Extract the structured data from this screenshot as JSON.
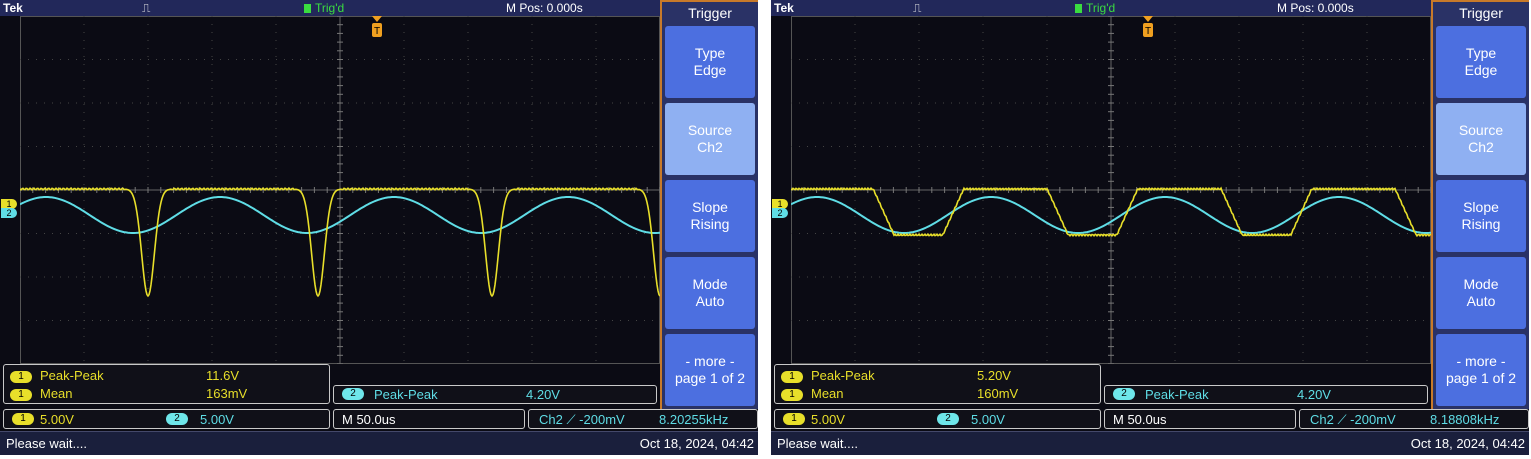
{
  "screens": [
    {
      "id": "left",
      "brand": "Tek",
      "trigger_pulse_symbol": "⎍",
      "trig_status": "Trig'd",
      "m_pos": "M Pos: 0.000s",
      "menu": {
        "title": "Trigger",
        "buttons": [
          {
            "line1": "Type",
            "line2": "Edge",
            "selected": false
          },
          {
            "line1": "Source",
            "line2": "Ch2",
            "selected": true
          },
          {
            "line1": "Slope",
            "line2": "Rising",
            "selected": false
          },
          {
            "line1": "Mode",
            "line2": "Auto",
            "selected": false
          },
          {
            "line1": "- more -",
            "line2": "page 1 of 2",
            "selected": false
          }
        ]
      },
      "measurements": {
        "ch1": [
          {
            "channel": "1",
            "label": "Peak-Peak",
            "value": "11.6V"
          },
          {
            "channel": "1",
            "label": "Mean",
            "value": "163mV"
          }
        ],
        "ch2": {
          "channel": "2",
          "label": "Peak-Peak",
          "value": "4.20V"
        }
      },
      "status": {
        "ch1_badge": "1",
        "ch1_scale": "5.00V",
        "ch2_badge": "2",
        "ch2_scale": "5.00V",
        "timebase": "M 50.0us",
        "trigger_source": "Ch2 ⟋ -200mV",
        "frequency": "8.20255kHz"
      },
      "footer": {
        "message": "Please wait....",
        "datetime": "Oct 18, 2024, 04:42"
      },
      "waveform": {
        "ch1_shape": "narrow-dips",
        "ch2_shape": "sine"
      }
    },
    {
      "id": "right",
      "brand": "Tek",
      "trigger_pulse_symbol": "⎍",
      "trig_status": "Trig'd",
      "m_pos": "M Pos: 0.000s",
      "menu": {
        "title": "Trigger",
        "buttons": [
          {
            "line1": "Type",
            "line2": "Edge",
            "selected": false
          },
          {
            "line1": "Source",
            "line2": "Ch2",
            "selected": true
          },
          {
            "line1": "Slope",
            "line2": "Rising",
            "selected": false
          },
          {
            "line1": "Mode",
            "line2": "Auto",
            "selected": false
          },
          {
            "line1": "- more -",
            "line2": "page 1 of 2",
            "selected": false
          }
        ]
      },
      "measurements": {
        "ch1": [
          {
            "channel": "1",
            "label": "Peak-Peak",
            "value": "5.20V"
          },
          {
            "channel": "1",
            "label": "Mean",
            "value": "160mV"
          }
        ],
        "ch2": {
          "channel": "2",
          "label": "Peak-Peak",
          "value": "4.20V"
        }
      },
      "status": {
        "ch1_badge": "1",
        "ch1_scale": "5.00V",
        "ch2_badge": "2",
        "ch2_scale": "5.00V",
        "timebase": "M 50.0us",
        "trigger_source": "Ch2 ⟋ -200mV",
        "frequency": "8.18808kHz"
      },
      "footer": {
        "message": "Please wait....",
        "datetime": "Oct 18, 2024, 04:42"
      },
      "waveform": {
        "ch1_shape": "trapezoid",
        "ch2_shape": "sine"
      }
    }
  ],
  "colors": {
    "screen_bg": "#0b0b14",
    "ch1": "#e8df2a",
    "ch2": "#5fdde6",
    "menu_button": "#4c6fe0",
    "menu_button_selected": "#8fb0f2",
    "trigger_marker": "#f0a020",
    "trig_status": "#3adc40"
  }
}
